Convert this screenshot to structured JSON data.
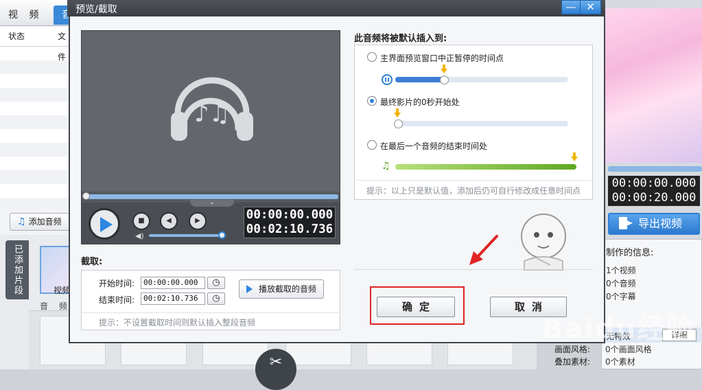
{
  "background": {
    "tabs": [
      "视 频",
      "音"
    ],
    "col_headers": [
      "状态",
      "文件"
    ],
    "add_audio_label": "添加音频",
    "added_clips_tab": "已添加片段",
    "thumb_label": "视频",
    "audio_row_label": "音 频",
    "preview_time_current": "00:00:00.000",
    "preview_time_total": "00:00:20.000",
    "export_label": "导出视频",
    "info_title": "制作的信息:",
    "info_lines": [
      "1个视频",
      "0个音频",
      "0个字幕"
    ],
    "special_effect": "无特效",
    "detail_label": "详细",
    "style_label": "画面风格:",
    "style_value": "0个画面风格",
    "overlay_label": "叠加素材:",
    "overlay_value": "0个素材",
    "watermark": "Baidu经验"
  },
  "dialog": {
    "title": "预览/截取",
    "minimize_glyph": "—",
    "close_glyph": "✕",
    "player": {
      "current_time": "00:00:00.000",
      "total_time": "00:02:10.736",
      "seek_fraction": 0,
      "volume_fraction": 0.95
    },
    "clip": {
      "section_label": "截取:",
      "start_label": "开始时间:",
      "start_value": "00:00:00.000",
      "end_label": "结束时间:",
      "end_value": "00:02:10.736",
      "play_clip_label": "播放截取的音频",
      "hint": "提示：不设置截取时间则默认插入整段音频"
    },
    "insert": {
      "section_label": "此音频将被默认插入到:",
      "options": [
        {
          "label": "主界面预览窗口中正暂停的时间点",
          "selected": false,
          "position_fraction": 0.28
        },
        {
          "label": "最终影片的0秒开始处",
          "selected": true,
          "position_fraction": 0
        },
        {
          "label": "在最后一个音频的结束时间处",
          "selected": false,
          "position_fraction": 1
        }
      ],
      "hint": "提示：以上只是默认值，添加后仍可自行修改成任意时间点"
    },
    "ok_label": "确定",
    "cancel_label": "取消"
  },
  "colors": {
    "accent_blue": "#2d7fd6",
    "highlight_red": "#e02424",
    "marker_yellow": "#f1b400",
    "green": "#5fa823"
  }
}
